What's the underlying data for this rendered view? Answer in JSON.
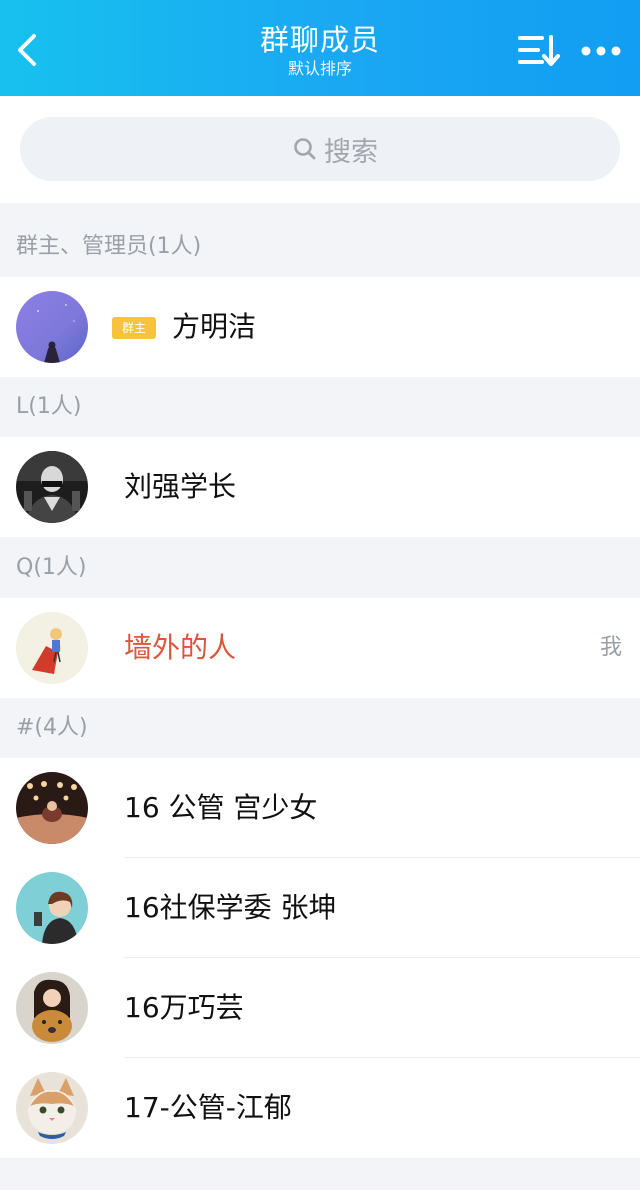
{
  "header": {
    "title": "群聊成员",
    "subtitle": "默认排序",
    "back_icon": "chevron-left-icon",
    "sort_icon": "sort-icon",
    "more_icon": "more-dots-icon",
    "background": "#1aa7f3"
  },
  "search": {
    "placeholder": "搜索",
    "icon": "search-icon"
  },
  "sections": [
    {
      "label": "群主、管理员(1人)",
      "members": [
        {
          "name": "方明洁",
          "badge": "群主",
          "badge_color": "#f8c23a"
        }
      ]
    },
    {
      "label": "L(1人)",
      "members": [
        {
          "name": "刘强学长"
        }
      ]
    },
    {
      "label": "Q(1人)",
      "members": [
        {
          "name": "墙外的人",
          "name_color": "#d9573a",
          "tag": "我"
        }
      ]
    },
    {
      "label": "#(4人)",
      "members": [
        {
          "name": "16 公管 宫少女"
        },
        {
          "name": "16社保学委 张坤"
        },
        {
          "name": "16万巧芸"
        },
        {
          "name": "17-公管-江郁"
        }
      ]
    }
  ]
}
